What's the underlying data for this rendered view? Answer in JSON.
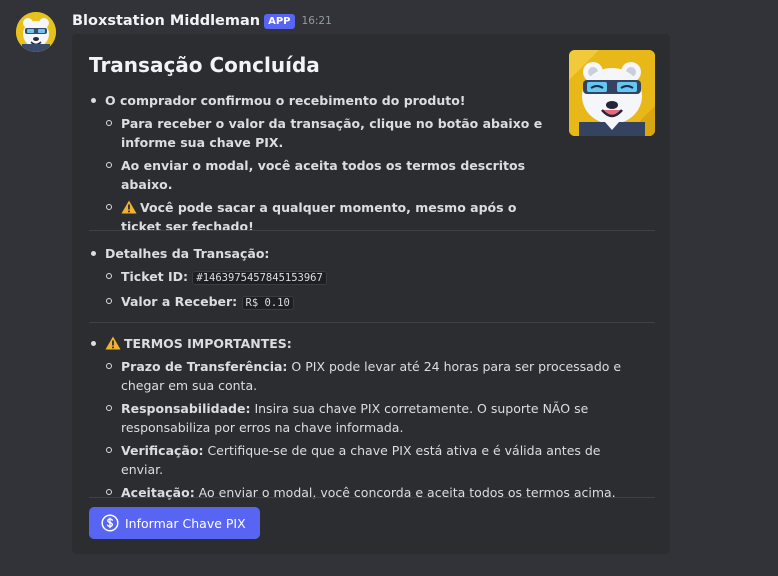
{
  "author": {
    "name": "Bloxstation Middleman",
    "badge": "APP",
    "timestamp": "16:21",
    "avatar_icon": "polar-bear-mascot-icon"
  },
  "embed": {
    "title": "Transação Concluída",
    "thumbnail_icon": "polar-bear-mascot-icon",
    "sections": {
      "intro": {
        "main": "O comprador confirmou o recebimento do produto!",
        "items": [
          "Para receber o valor da transação, clique no botão abaixo e informe sua chave PIX.",
          "Ao enviar o modal, você aceita todos os termos descritos abaixo.",
          "Você pode sacar a qualquer momento, mesmo após o ticket ser fechado!"
        ]
      },
      "details": {
        "main": "Detalhes da Transação:",
        "ticket_label": "Ticket ID:",
        "ticket_value": "#1463975457845153967",
        "amount_label": "Valor a Receber:",
        "amount_value": "R$ 0.10"
      },
      "terms": {
        "main": "TERMOS IMPORTANTES:",
        "items": [
          {
            "label": "Prazo de Transferência:",
            "text": " O PIX pode levar até 24 horas para ser processado e chegar em sua conta."
          },
          {
            "label": "Responsabilidade:",
            "text": " Insira sua chave PIX corretamente. O suporte NÃO se responsabiliza por erros na chave informada."
          },
          {
            "label": "Verificação:",
            "text": " Certifique-se de que a chave PIX está ativa e é válida antes de enviar."
          },
          {
            "label": "Aceitação:",
            "text": " Ao enviar o modal, você concorda e aceita todos os termos acima."
          }
        ]
      }
    },
    "button": {
      "label": "Informar Chave PIX",
      "icon": "dollar-coin-icon"
    }
  },
  "colors": {
    "background": "#313338",
    "embed_bg": "#2b2d31",
    "accent": "#5865f2",
    "warning": "#f0b232"
  }
}
